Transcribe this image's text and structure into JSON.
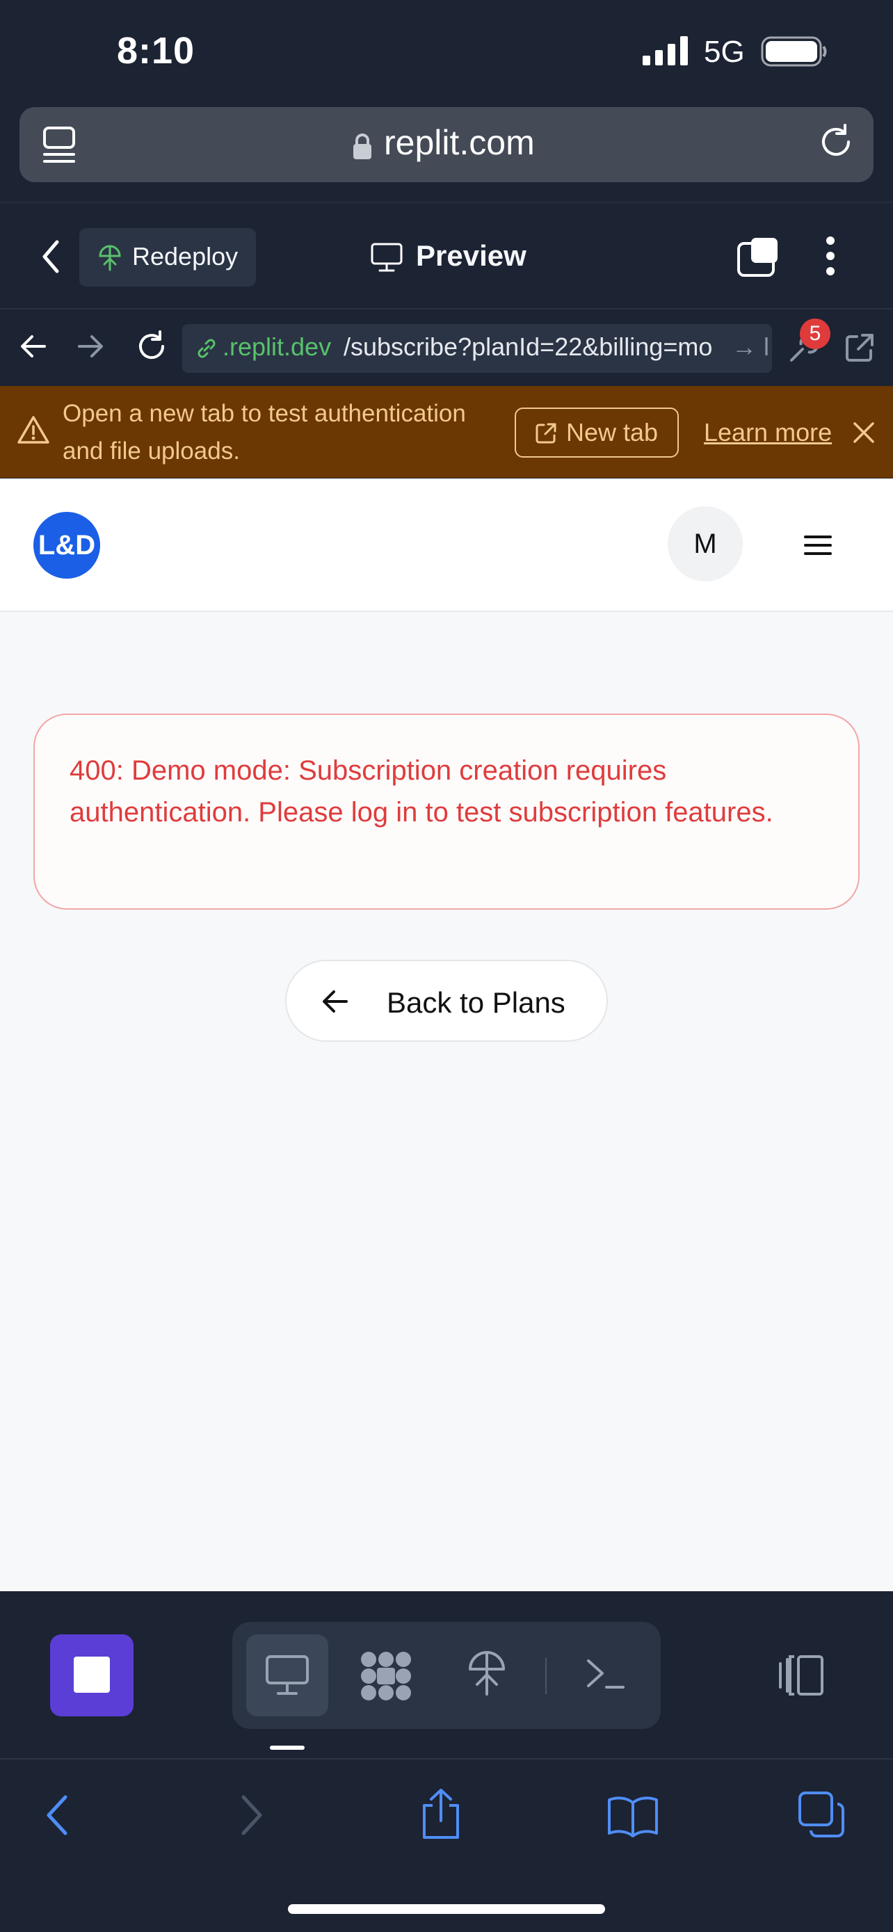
{
  "status_bar": {
    "time": "8:10",
    "network": "5G"
  },
  "browser": {
    "url": "replit.com"
  },
  "replit_header": {
    "redeploy_label": "Redeploy",
    "preview_label": "Preview"
  },
  "preview_toolbar": {
    "url_domain": ".replit.dev",
    "url_path": "/subscribe?planId=22&billing=mo",
    "url_overflow": "→ l",
    "console_badge": "5"
  },
  "banner": {
    "message": "Open a new tab to test authentication and file uploads.",
    "new_tab_label": "New tab",
    "learn_more_label": "Learn more"
  },
  "app": {
    "logo_text": "L&D",
    "avatar_initial": "M",
    "error_message": "400: Demo mode: Subscription creation requires authentication. Please log in to test subscription features.",
    "back_button_label": "Back to Plans"
  },
  "colors": {
    "replit_bg": "#1c2333",
    "accent_purple": "#5b3ed6",
    "logo_blue": "#1a5fe6",
    "error_red": "#df3c3c",
    "banner_bg": "#6b3703",
    "banner_text": "#f3c98e",
    "link_green": "#58c26a"
  }
}
